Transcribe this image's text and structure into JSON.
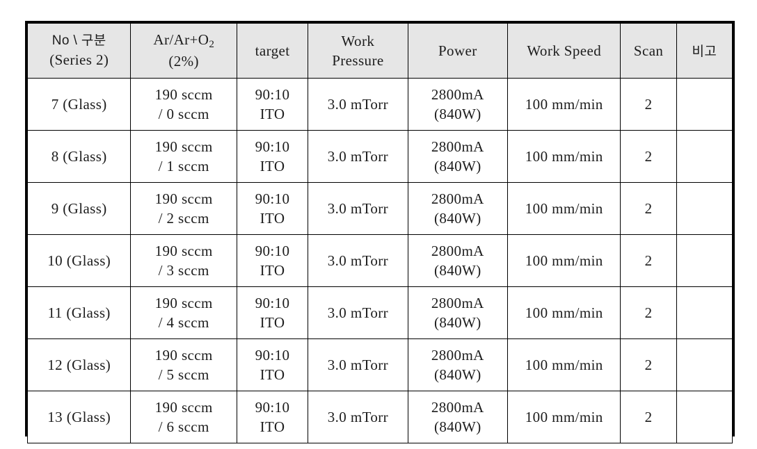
{
  "table": {
    "columns": [
      {
        "key": "no",
        "line1": "No \\ 구분",
        "line2": "(Series 2)"
      },
      {
        "key": "gas",
        "line1": "Ar/Ar+O2",
        "line2": "(2%)"
      },
      {
        "key": "target",
        "line1": "target",
        "line2": ""
      },
      {
        "key": "press",
        "line1": "Work",
        "line2": "Pressure"
      },
      {
        "key": "power",
        "line1": "Power",
        "line2": ""
      },
      {
        "key": "speed",
        "line1": "Work Speed",
        "line2": ""
      },
      {
        "key": "scan",
        "line1": "Scan",
        "line2": ""
      },
      {
        "key": "note",
        "line1": "비고",
        "line2": ""
      }
    ],
    "rows": [
      {
        "no": "7 (Glass)",
        "gas_line1": "190 sccm",
        "gas_line2": "/ 0 sccm",
        "target_line1": "90:10",
        "target_line2": "ITO",
        "press": "3.0 mTorr",
        "power_line1": "2800mA",
        "power_line2": "(840W)",
        "speed": "100 mm/min",
        "scan": "2",
        "note": ""
      },
      {
        "no": "8 (Glass)",
        "gas_line1": "190 sccm",
        "gas_line2": "/ 1 sccm",
        "target_line1": "90:10",
        "target_line2": "ITO",
        "press": "3.0 mTorr",
        "power_line1": "2800mA",
        "power_line2": "(840W)",
        "speed": "100 mm/min",
        "scan": "2",
        "note": ""
      },
      {
        "no": "9 (Glass)",
        "gas_line1": "190 sccm",
        "gas_line2": "/ 2 sccm",
        "target_line1": "90:10",
        "target_line2": "ITO",
        "press": "3.0 mTorr",
        "power_line1": "2800mA",
        "power_line2": "(840W)",
        "speed": "100 mm/min",
        "scan": "2",
        "note": ""
      },
      {
        "no": "10 (Glass)",
        "gas_line1": "190 sccm",
        "gas_line2": "/ 3 sccm",
        "target_line1": "90:10",
        "target_line2": "ITO",
        "press": "3.0 mTorr",
        "power_line1": "2800mA",
        "power_line2": "(840W)",
        "speed": "100 mm/min",
        "scan": "2",
        "note": ""
      },
      {
        "no": "11 (Glass)",
        "gas_line1": "190 sccm",
        "gas_line2": "/ 4 sccm",
        "target_line1": "90:10",
        "target_line2": "ITO",
        "press": "3.0 mTorr",
        "power_line1": "2800mA",
        "power_line2": "(840W)",
        "speed": "100 mm/min",
        "scan": "2",
        "note": ""
      },
      {
        "no": "12 (Glass)",
        "gas_line1": "190 sccm",
        "gas_line2": "/ 5 sccm",
        "target_line1": "90:10",
        "target_line2": "ITO",
        "press": "3.0 mTorr",
        "power_line1": "2800mA",
        "power_line2": "(840W)",
        "speed": "100 mm/min",
        "scan": "2",
        "note": ""
      },
      {
        "no": "13 (Glass)",
        "gas_line1": "190 sccm",
        "gas_line2": "/ 6 sccm",
        "target_line1": "90:10",
        "target_line2": "ITO",
        "press": "3.0 mTorr",
        "power_line1": "2800mA",
        "power_line2": "(840W)",
        "speed": "100 mm/min",
        "scan": "2",
        "note": ""
      }
    ]
  },
  "colors": {
    "header_background": "#e6e6e6",
    "border": "#000000",
    "text": "#1c1c1c",
    "page_background": "#ffffff"
  }
}
